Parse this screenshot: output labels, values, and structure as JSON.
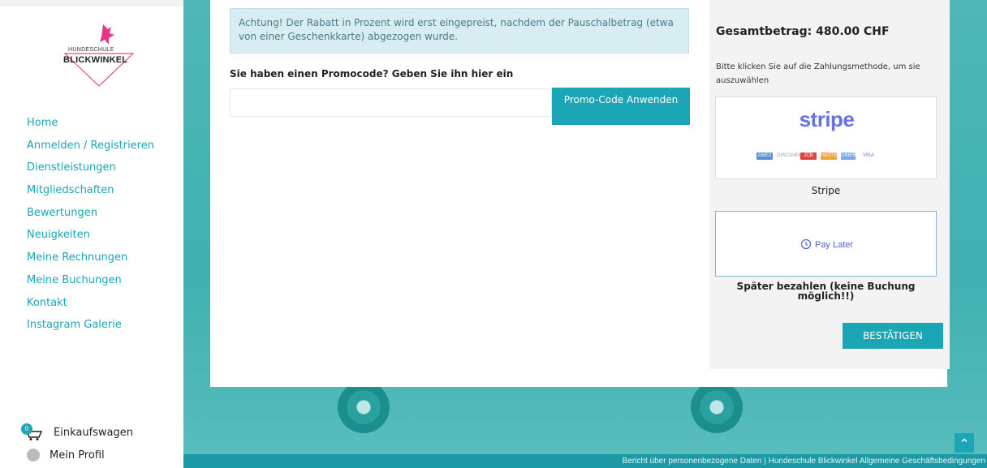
{
  "brand": {
    "line1": "HUNDESCHULE",
    "line2": "BLICKWINKEL"
  },
  "nav": [
    "Home",
    "Anmelden / Registrieren",
    "Dienstleistungen",
    "Mitgliedschaften",
    "Bewertungen",
    "Neuigkeiten",
    "Meine Rechnungen",
    "Meine Buchungen",
    "Kontakt",
    "Instagram Galerie"
  ],
  "cart": {
    "count": "0",
    "label": "Einkaufswagen"
  },
  "profile": {
    "label": "Mein Profil"
  },
  "notice": "Achtung! Der Rabatt in Prozent wird erst eingepreist, nachdem der Pauschalbetrag (etwa von einer Geschenkkarte) abgezogen wurde.",
  "promo": {
    "title": "Sie haben einen Promocode? Geben Sie ihn hier ein",
    "value": "",
    "button": "Promo-Code Anwenden"
  },
  "summary": {
    "total": "Gesamtbetrag: 480.00 CHF",
    "hint": "Bitte klicken Sie auf die Zahlungsmethode, um sie auszuwählen"
  },
  "payment": {
    "stripe": {
      "logo": "stripe",
      "cards": [
        "AMEX",
        "DISCOVER",
        "JCB",
        "MASTERCARD",
        "DINERS",
        "VISA"
      ],
      "label": "Stripe"
    },
    "paylater": {
      "logo": "Pay Later",
      "label": "Später bezahlen (keine Buchung möglich!!)"
    }
  },
  "confirm": "BESTÄTIGEN",
  "footer": "Bericht über personenbezogene Daten  |  Hundeschule Blickwinkel Allgemeine Geschäftsbedingungen",
  "colors": {
    "accent": "#1aa6b5",
    "stripe": "#6772e5"
  }
}
